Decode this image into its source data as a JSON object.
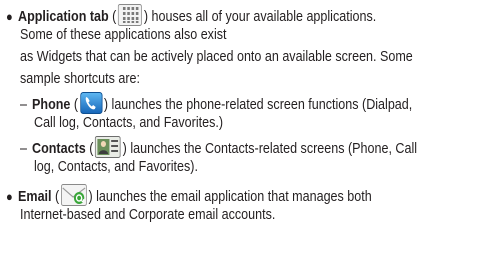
{
  "bullets": {
    "application_tab": {
      "title": "Application tab",
      "paren_open": "(",
      "icon": "app-grid-icon",
      "text_1": ") houses all of your available applications.",
      "text_2": "Some of these applications also exist",
      "text_3": "as Widgets that can be actively placed onto an available screen. Some",
      "text_4": "sample shortcuts are:"
    },
    "phone": {
      "dash": "–",
      "title": "Phone",
      "paren_open": "(",
      "icon": "phone-icon",
      "text_1": ") launches the phone-related screen functions (Dialpad,",
      "text_2": "Call log, Contacts, and Favorites.)"
    },
    "contacts": {
      "dash": "–",
      "title": "Contacts",
      "paren_open": "(",
      "icon": "contacts-icon",
      "text_1": ") launches the Contacts-related screens (Phone, Call",
      "text_2": "log, Contacts, and Favorites)."
    },
    "email": {
      "title": "Email",
      "paren_open": "(",
      "icon": "email-icon",
      "text_1": ") launches the email application that manages both",
      "text_2": "Internet-based and Corporate email accounts."
    }
  },
  "colors": {
    "text": "#231f20",
    "phone_icon_bg": "#1e88d8",
    "email_icon_accent": "#3aa63a"
  }
}
